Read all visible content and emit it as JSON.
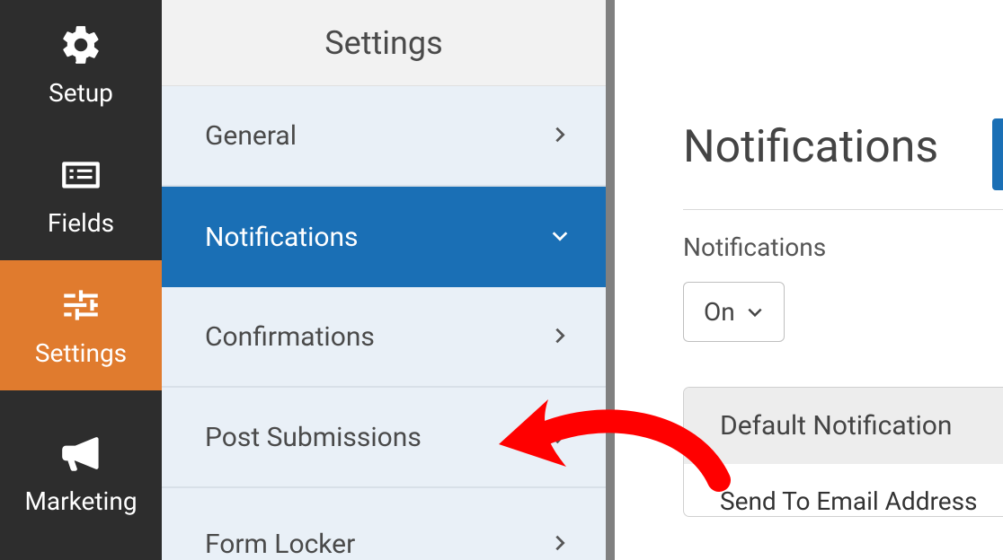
{
  "header": {
    "title": "Settings"
  },
  "rail": {
    "items": [
      {
        "label": "Setup"
      },
      {
        "label": "Fields"
      },
      {
        "label": "Settings"
      },
      {
        "label": "Marketing"
      }
    ]
  },
  "settings_list": {
    "items": [
      {
        "label": "General"
      },
      {
        "label": "Notifications"
      },
      {
        "label": "Confirmations"
      },
      {
        "label": "Post Submissions"
      },
      {
        "label": "Form Locker"
      }
    ]
  },
  "panel": {
    "title": "Notifications",
    "section_label": "Notifications",
    "toggle_value": "On",
    "card_title": "Default Notification",
    "card_field_label": "Send To Email Address"
  }
}
